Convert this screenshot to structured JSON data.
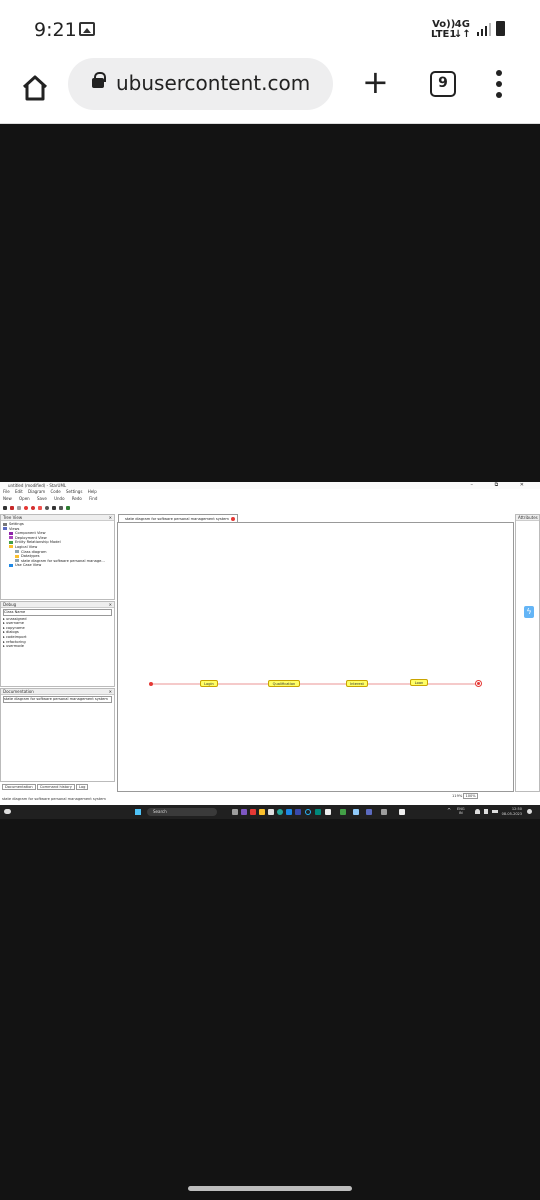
{
  "status_bar": {
    "time": "9:21",
    "volte_top": "Vo))",
    "volte_bottom": "LTE1",
    "network_top": "4G",
    "network_bottom": "↓↑"
  },
  "browser": {
    "url": "ubusercontent.com",
    "tab_count": "9"
  },
  "app": {
    "window_title": "untitled (modified) - StarUML",
    "window_controls": "– ⧉ ✕",
    "menu": [
      "File",
      "Edit",
      "Diagram",
      "Code",
      "Settings",
      "Help"
    ],
    "toolbar": [
      "New",
      "Open",
      "Save",
      "Undo",
      "Redo",
      "Find"
    ],
    "tree_view": {
      "title": "Tree View",
      "items": [
        "Settings",
        "Views",
        "Component View",
        "Deployment View",
        "Entity Relationship Model",
        "Logical View",
        "Class diagram",
        "Datatypes",
        "state diagram for software personal manage...",
        "Use Case View"
      ]
    },
    "debug": {
      "title": "Debug",
      "column": "Class Name",
      "items": [
        "unassigned",
        "username",
        "copyname",
        "dialogs",
        "codeimport",
        "refactoring",
        "usermode"
      ]
    },
    "documentation": {
      "title": "Documentation",
      "text": "state diagram for software personal management system"
    },
    "bottom_tabs": [
      "Documentation",
      "Command history",
      "Log"
    ],
    "diagram_tab": "state diagram for software personal management system",
    "right_panel_title": "Attributes",
    "states": [
      "Login",
      "Qualification",
      "Interest",
      "Loan"
    ],
    "zoom_left": "119%",
    "zoom_right": "100%",
    "status_text": "state diagram for software personal management system"
  },
  "taskbar": {
    "search": "Search",
    "lang": "ENG",
    "region": "IN",
    "clock_time": "12:50",
    "clock_date": "08-05-2023"
  },
  "colors": {
    "page_background": "#131313",
    "state_fill": "#ffff66",
    "transition_line": "#e57373",
    "taskbar": "#202020"
  }
}
